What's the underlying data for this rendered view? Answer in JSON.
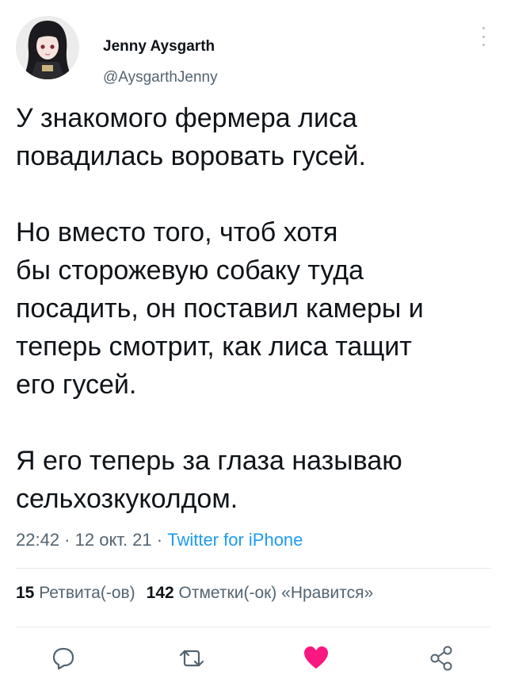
{
  "author": {
    "name": "Jenny Aysgarth",
    "handle": "@AysgarthJenny"
  },
  "tweet": {
    "text": "У знакомого фермера лиса\nповадилась воровать гусей.\n\nНо вместо того, чтоб хотя\nбы сторожевую собаку туда\nпосадить, он поставил камеры и\nтеперь смотрит, как лиса тащит\nего гусей.\n\nЯ его теперь за глаза называю\nсельхозкуколдом.",
    "time": "22:42",
    "date": "12 окт. 21",
    "source": "Twitter for iPhone"
  },
  "stats": {
    "retweets_count": "15",
    "retweets_label": "Ретвита(-ов)",
    "likes_count": "142",
    "likes_label": "Отметки(-ок) «Нравится»"
  },
  "icons": {
    "reply": "reply-icon",
    "retweet": "retweet-icon",
    "like": "heart-icon",
    "share": "share-icon",
    "more": "more-options-icon"
  },
  "colors": {
    "text": "#0f1419",
    "secondary": "#536471",
    "link": "#1d9bf0",
    "like": "#f91880",
    "divider": "#e6e9eb"
  }
}
